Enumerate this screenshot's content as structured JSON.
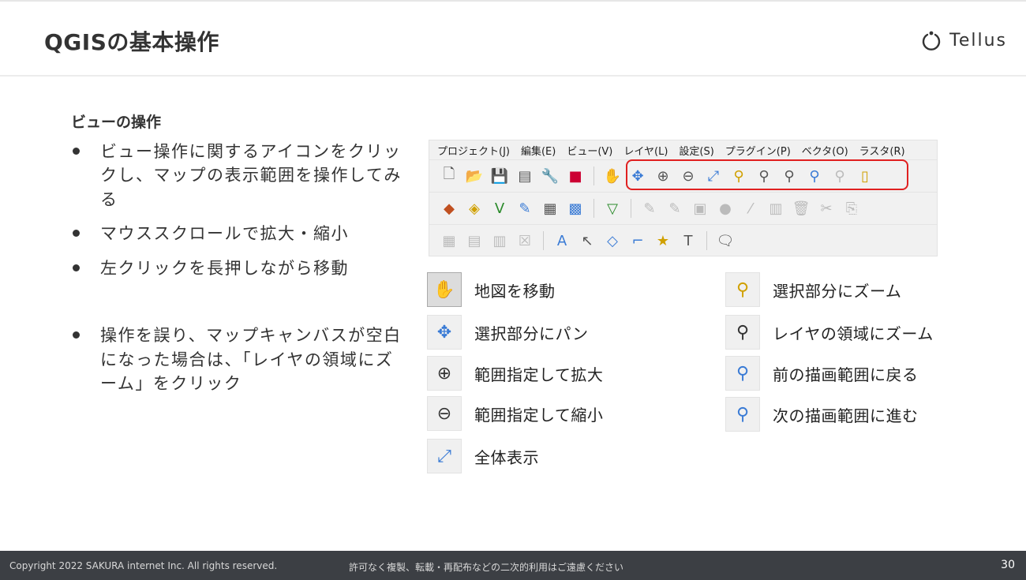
{
  "header": {
    "title": "QGISの基本操作",
    "logo_text": "Tellus"
  },
  "left": {
    "subheading": "ビューの操作",
    "bullets": [
      "ビュー操作に関するアイコンをクリックし、マップの表示範囲を操作してみる",
      "マウススクロールで拡大・縮小",
      "左クリックを長押しながら移動",
      "操作を誤り、マップキャンバスが空白になった場合は、「レイヤの領域にズーム」をクリック"
    ]
  },
  "toolbar": {
    "menu": [
      "プロジェクト(J)",
      "編集(E)",
      "ビュー(V)",
      "レイヤ(L)",
      "設定(S)",
      "プラグイン(P)",
      "ベクタ(O)",
      "ラスタ(R)"
    ]
  },
  "legend": {
    "left": [
      "地図を移動",
      "選択部分にパン",
      "範囲指定して拡大",
      "範囲指定して縮小",
      "全体表示"
    ],
    "right": [
      "選択部分にズーム",
      "レイヤの領域にズーム",
      "前の描画範囲に戻る",
      "次の描画範囲に進む"
    ]
  },
  "footer": {
    "copyright": "Copyright 2022 SAKURA internet Inc. All rights reserved.",
    "notice": "許可なく複製、転載・再配布などの二次的利用はご遠慮ください",
    "page": "30"
  },
  "icons": [
    "pan-hand-icon",
    "pan-to-selection-icon",
    "zoom-in-icon",
    "zoom-out-icon",
    "zoom-full-icon",
    "zoom-to-selection-icon",
    "zoom-to-layer-icon",
    "zoom-last-icon",
    "zoom-next-icon"
  ]
}
